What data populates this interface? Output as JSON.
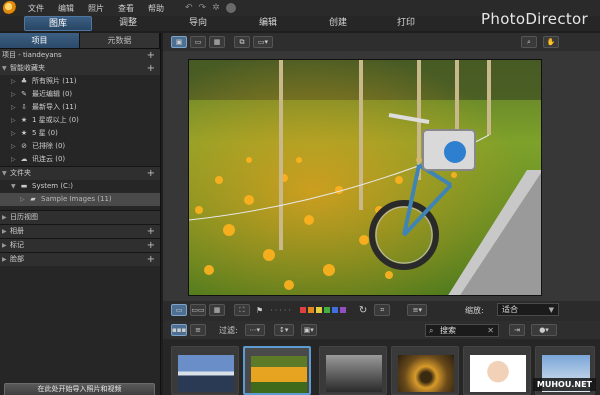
{
  "menu": {
    "items": [
      "文件",
      "编辑",
      "照片",
      "查看",
      "帮助"
    ]
  },
  "modes": [
    {
      "label": "图库",
      "active": true
    },
    {
      "label": "调整",
      "active": false
    },
    {
      "label": "导向",
      "active": false
    },
    {
      "label": "编辑",
      "active": false
    },
    {
      "label": "创建",
      "active": false
    },
    {
      "label": "打印",
      "active": false
    }
  ],
  "app_name": "PhotoDirector",
  "left": {
    "tabs": [
      "项目",
      "元数据"
    ],
    "project_title": "项目 - tiandeyans",
    "smart": {
      "title": "智能收藏夹",
      "items": [
        {
          "label": "所有照片 (11)",
          "icon": "people-icon"
        },
        {
          "label": "最近编辑 (0)",
          "icon": "edit-icon"
        },
        {
          "label": "最新导入 (11)",
          "icon": "import-icon"
        },
        {
          "label": "1 星或以上 (0)",
          "icon": "star-icon"
        },
        {
          "label": "5 星 (0)",
          "icon": "star-icon"
        },
        {
          "label": "已排除 (0)",
          "icon": "reject-icon"
        },
        {
          "label": "讯连云 (0)",
          "icon": "cloud-icon"
        }
      ]
    },
    "folders": {
      "title": "文件夹",
      "drive": "System (C:)",
      "folder": "Sample Images (11)"
    },
    "sections": [
      "日历视图",
      "相册",
      "标记",
      "脸部"
    ],
    "import_button": "在此处开始导入照片和视频"
  },
  "viewer": {
    "zoom_label": "缩放:",
    "zoom_value": "适合",
    "filter_label": "过滤:",
    "search_placeholder": "搜索"
  },
  "color_labels": [
    "#e04040",
    "#e08a20",
    "#e0d040",
    "#40b040",
    "#4070e0",
    "#9050c0"
  ],
  "watermark": "MUHOU.NET"
}
